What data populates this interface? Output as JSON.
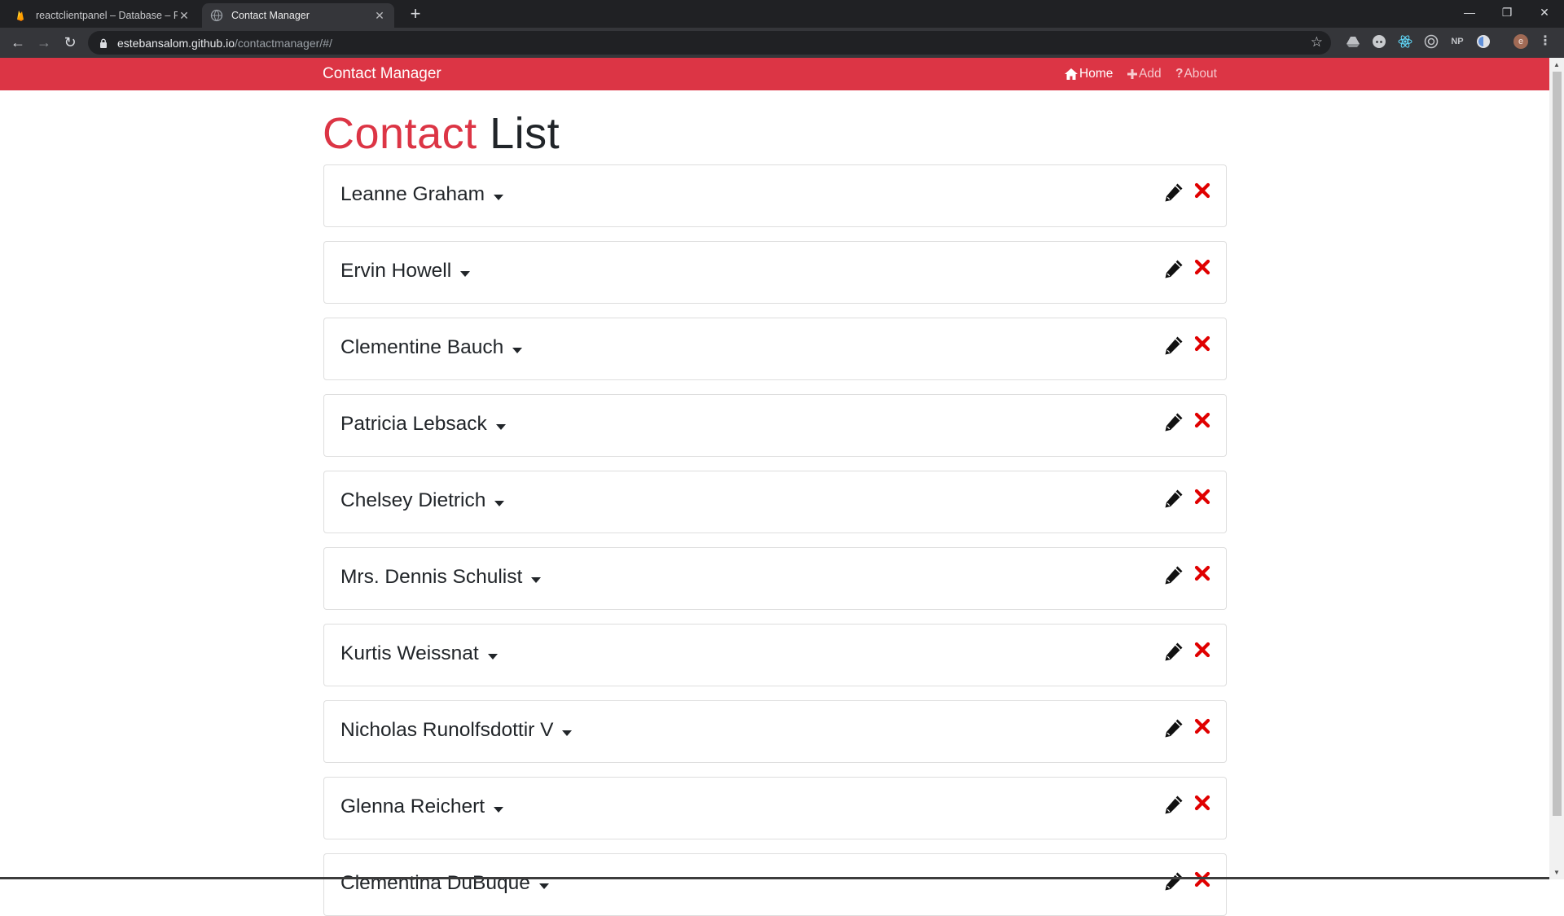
{
  "browser": {
    "tabs": [
      {
        "title": "reactclientpanel – Database – Fire",
        "active": false,
        "icon": "firebase-icon"
      },
      {
        "title": "Contact Manager",
        "active": true,
        "icon": "globe-icon"
      }
    ],
    "new_tab": "+",
    "url_host": "estebansalom.github.io",
    "url_path": "/contactmanager/#/",
    "extensions": [
      "drive-icon",
      "discord-icon",
      "react-icon",
      "target-icon",
      "NP",
      "ext-icon",
      "e"
    ]
  },
  "navbar": {
    "brand": "Contact Manager",
    "links": [
      {
        "label": "Home",
        "icon": "home-icon"
      },
      {
        "label": "Add",
        "icon": "plus-icon"
      },
      {
        "label": "About",
        "icon": "question-icon"
      }
    ],
    "color": "#dc3545"
  },
  "heading": {
    "accent": "Contact",
    "rest": "List"
  },
  "contacts": [
    {
      "name": "Leanne Graham"
    },
    {
      "name": "Ervin Howell"
    },
    {
      "name": "Clementine Bauch"
    },
    {
      "name": "Patricia Lebsack"
    },
    {
      "name": "Chelsey Dietrich"
    },
    {
      "name": "Mrs. Dennis Schulist"
    },
    {
      "name": "Kurtis Weissnat"
    },
    {
      "name": "Nicholas Runolfsdottir V"
    },
    {
      "name": "Glenna Reichert"
    },
    {
      "name": "Clementina DuBuque"
    }
  ],
  "colors": {
    "accent": "#dc3545",
    "delete": "#e00000"
  }
}
